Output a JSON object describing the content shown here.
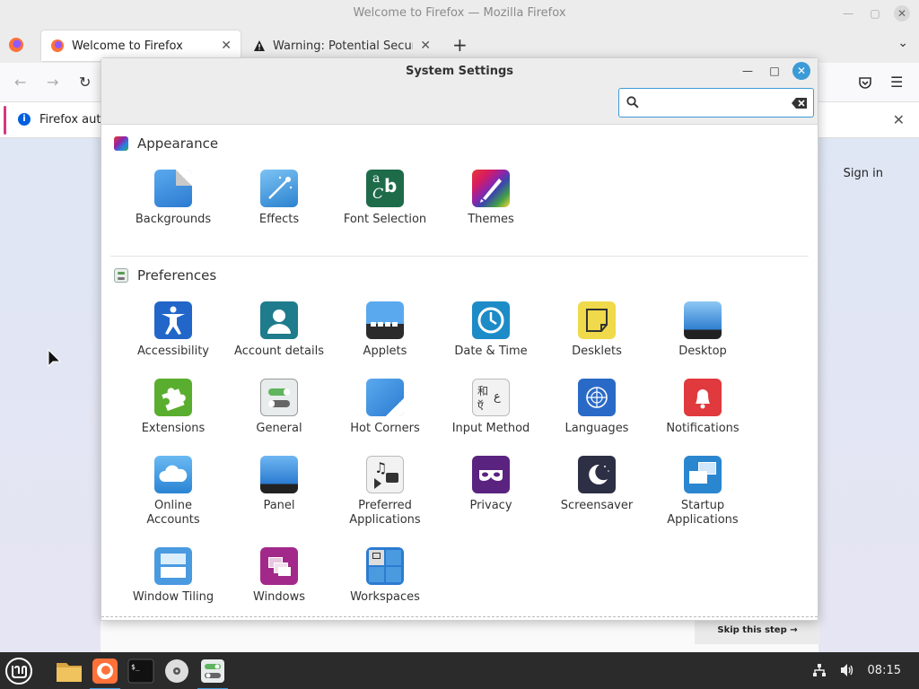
{
  "firefox": {
    "window_title": "Welcome to Firefox — Mozilla Firefox",
    "tabs": [
      {
        "label": "Welcome to Firefox"
      },
      {
        "label": "Warning: Potential Security"
      }
    ],
    "notice_text": "Firefox autc",
    "signin_label": "Sign in",
    "skip_label": "Skip this step →"
  },
  "settings": {
    "title": "System Settings",
    "search": {
      "value": "",
      "placeholder": ""
    },
    "sections": [
      {
        "title": "Appearance",
        "items": [
          {
            "label": "Backgrounds",
            "icon": "backgrounds-icon"
          },
          {
            "label": "Effects",
            "icon": "effects-icon"
          },
          {
            "label": "Font Selection",
            "icon": "font-selection-icon"
          },
          {
            "label": "Themes",
            "icon": "themes-icon"
          }
        ]
      },
      {
        "title": "Preferences",
        "items": [
          {
            "label": "Accessibility",
            "icon": "accessibility-icon"
          },
          {
            "label": "Account details",
            "icon": "account-details-icon"
          },
          {
            "label": "Applets",
            "icon": "applets-icon"
          },
          {
            "label": "Date & Time",
            "icon": "date-time-icon"
          },
          {
            "label": "Desklets",
            "icon": "desklets-icon"
          },
          {
            "label": "Desktop",
            "icon": "desktop-icon"
          },
          {
            "label": "Extensions",
            "icon": "extensions-icon"
          },
          {
            "label": "General",
            "icon": "general-icon"
          },
          {
            "label": "Hot Corners",
            "icon": "hot-corners-icon"
          },
          {
            "label": "Input Method",
            "icon": "input-method-icon"
          },
          {
            "label": "Languages",
            "icon": "languages-icon"
          },
          {
            "label": "Notifications",
            "icon": "notifications-icon"
          },
          {
            "label": "Online\nAccounts",
            "icon": "online-accounts-icon"
          },
          {
            "label": "Panel",
            "icon": "panel-icon"
          },
          {
            "label": "Preferred\nApplications",
            "icon": "preferred-applications-icon"
          },
          {
            "label": "Privacy",
            "icon": "privacy-icon"
          },
          {
            "label": "Screensaver",
            "icon": "screensaver-icon"
          },
          {
            "label": "Startup\nApplications",
            "icon": "startup-applications-icon"
          },
          {
            "label": "Window Tiling",
            "icon": "window-tiling-icon"
          },
          {
            "label": "Windows",
            "icon": "windows-icon"
          },
          {
            "label": "Workspaces",
            "icon": "workspaces-icon"
          }
        ]
      }
    ]
  },
  "taskbar": {
    "clock": "08:15",
    "apps": [
      "menu-icon",
      "files-icon",
      "firefox-icon",
      "terminal-icon",
      "disc-icon",
      "settings-icon"
    ]
  },
  "colors": {
    "accent": "#3c9bd6",
    "taskbar_bg": "#2b2b2b"
  }
}
